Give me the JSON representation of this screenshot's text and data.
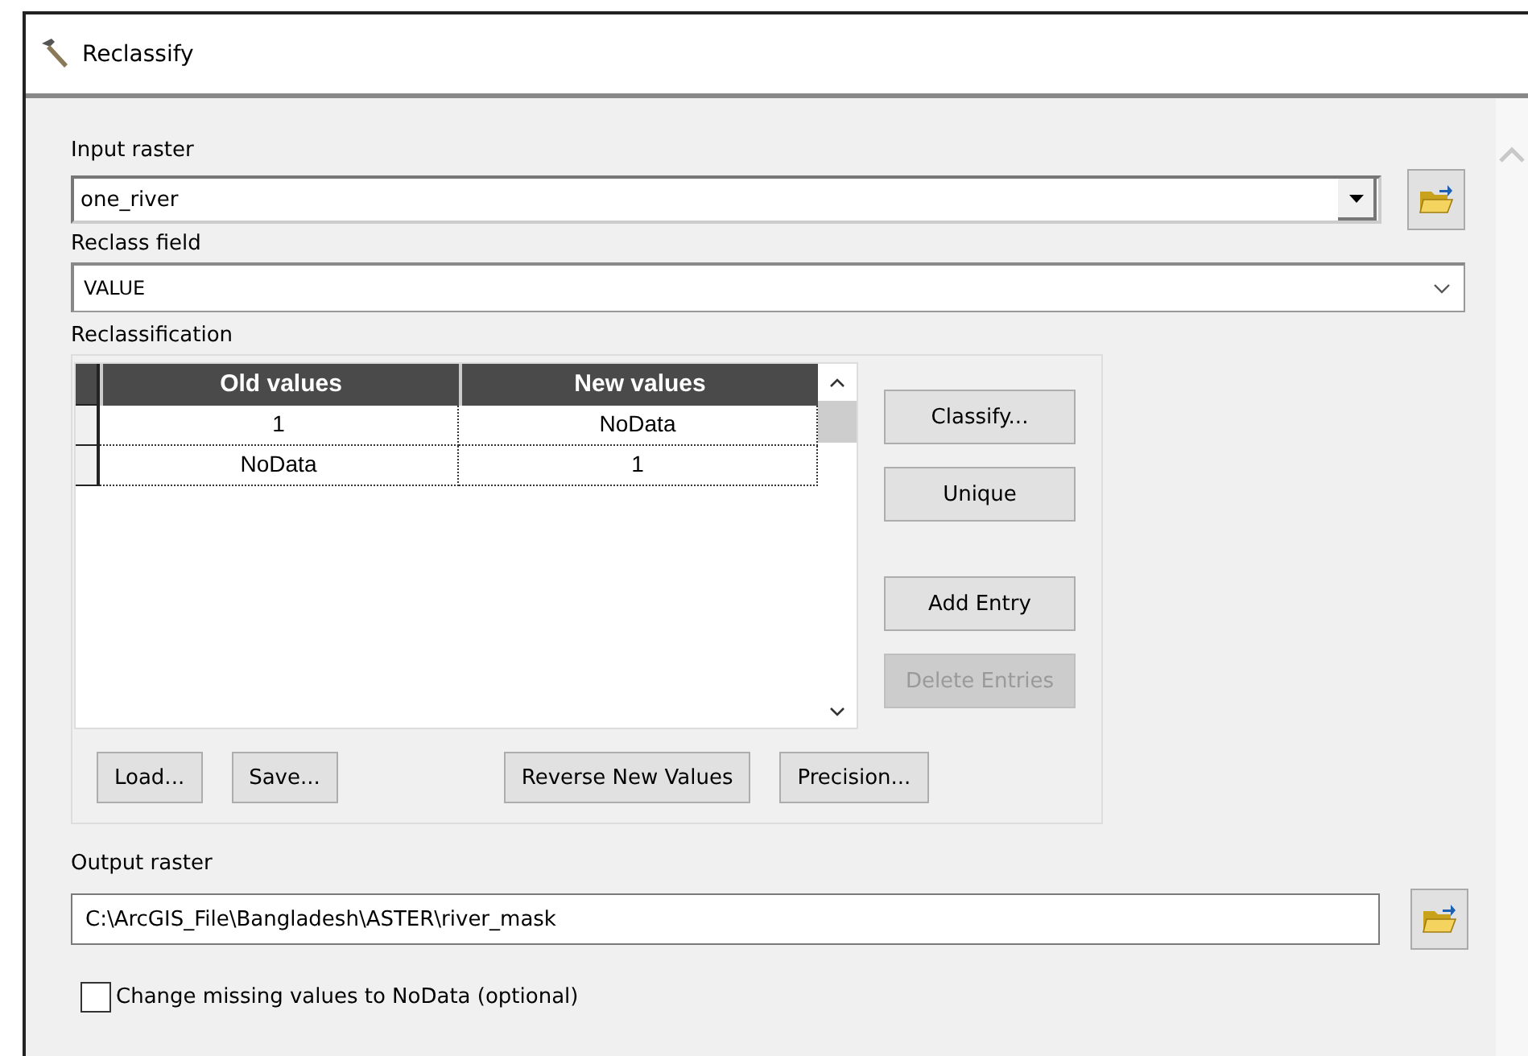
{
  "window": {
    "title": "Reclassify"
  },
  "input_raster": {
    "label": "Input raster",
    "value": "one_river"
  },
  "reclass_field": {
    "label": "Reclass field",
    "value": "VALUE"
  },
  "reclassification": {
    "label": "Reclassification",
    "table": {
      "columns": [
        "Old values",
        "New values"
      ],
      "rows": [
        [
          "1",
          "NoData"
        ],
        [
          "NoData",
          "1"
        ]
      ]
    },
    "side_buttons": [
      {
        "label": "Classify...",
        "disabled": false
      },
      {
        "label": "Unique",
        "disabled": false
      },
      {
        "label": "Add Entry",
        "disabled": false
      },
      {
        "label": "Delete Entries",
        "disabled": true
      }
    ],
    "bottom_buttons": [
      {
        "label": "Load..."
      },
      {
        "label": "Save..."
      },
      {
        "label": "Reverse New Values"
      },
      {
        "label": "Precision..."
      }
    ]
  },
  "output_raster": {
    "label": "Output raster",
    "value": "C:\\ArcGIS_File\\Bangladesh\\ASTER\\river_mask"
  },
  "missing_to_nodata": {
    "label": "Change missing values to NoData (optional)",
    "checked": false
  }
}
